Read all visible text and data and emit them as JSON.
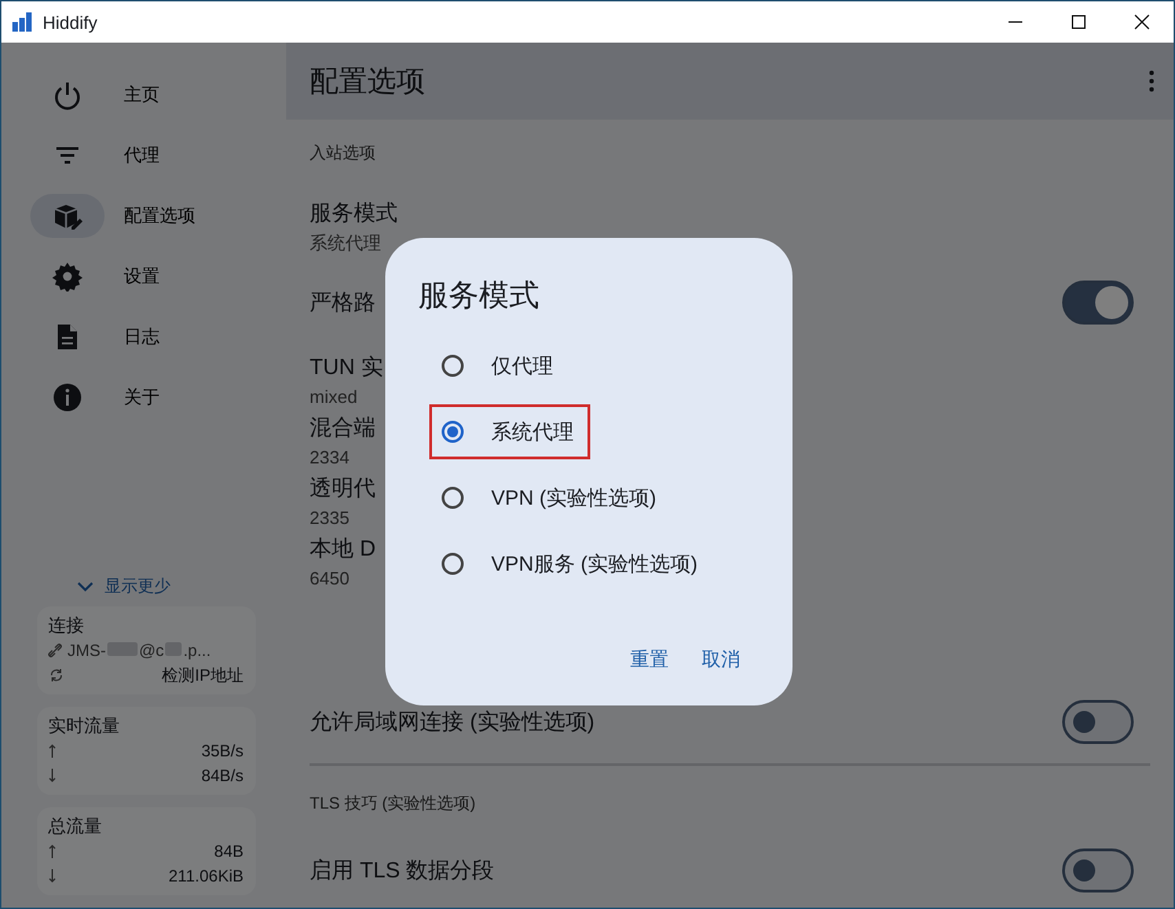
{
  "window": {
    "title": "Hiddify"
  },
  "sidebar": {
    "items": [
      {
        "label": "主页",
        "selected": false
      },
      {
        "label": "代理",
        "selected": false
      },
      {
        "label": "配置选项",
        "selected": true
      },
      {
        "label": "设置",
        "selected": false
      },
      {
        "label": "日志",
        "selected": false
      },
      {
        "label": "关于",
        "selected": false
      }
    ],
    "collapse_label": "显示更少",
    "connection": {
      "title": "连接",
      "link_parts": [
        "JMS-",
        "@c",
        ".p..."
      ],
      "action": "检测IP地址"
    },
    "stats": [
      {
        "title": "实时流量",
        "upload": "35B/s",
        "download": "84B/s"
      },
      {
        "title": "总流量",
        "upload": "84B",
        "download": "211.06KiB"
      }
    ]
  },
  "content": {
    "title": "配置选项",
    "rows": [
      {
        "kind": "header",
        "label": "入站选项"
      },
      {
        "kind": "item",
        "title": "服务模式",
        "value": "系统代理"
      },
      {
        "kind": "switch",
        "title": "严格路",
        "on": true
      },
      {
        "kind": "item",
        "title": "TUN 实",
        "value": "mixed"
      },
      {
        "kind": "item",
        "title": "混合端",
        "value": "2334"
      },
      {
        "kind": "item",
        "title": "透明代",
        "value": "2335"
      },
      {
        "kind": "item",
        "title": "本地 D",
        "value": "6450"
      },
      {
        "kind": "switch",
        "title": "允许局域网连接 (实验性选项)",
        "on": false
      },
      {
        "kind": "divider"
      },
      {
        "kind": "header",
        "label": "TLS 技巧 (实验性选项)"
      },
      {
        "kind": "switch",
        "title": "启用 TLS 数据分段",
        "on": false
      }
    ]
  },
  "dialog": {
    "title": "服务模式",
    "options": [
      {
        "label": "仅代理",
        "selected": false,
        "highlighted": false
      },
      {
        "label": "系统代理",
        "selected": true,
        "highlighted": true
      },
      {
        "label": "VPN (实验性选项)",
        "selected": false,
        "highlighted": false
      },
      {
        "label": "VPN服务 (实验性选项)",
        "selected": false,
        "highlighted": false
      }
    ],
    "buttons": [
      "重置",
      "取消"
    ]
  }
}
